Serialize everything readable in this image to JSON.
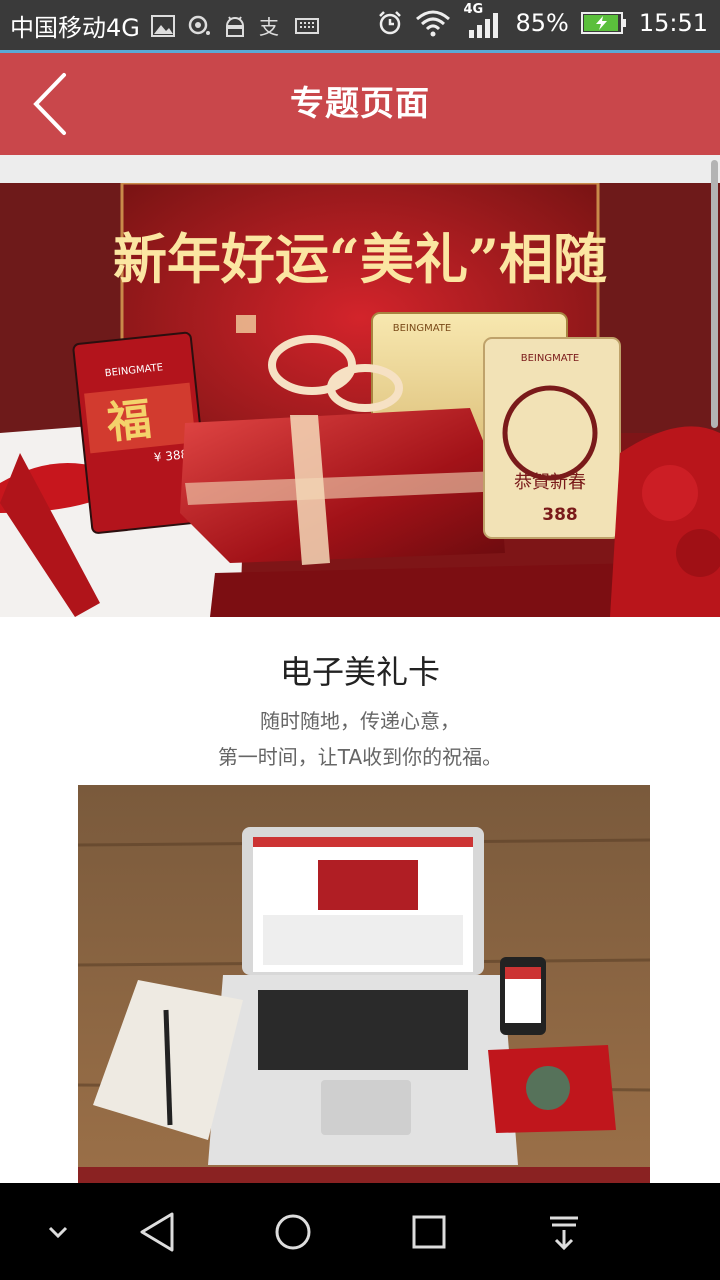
{
  "status_bar": {
    "carrier": "中国移动4G",
    "network_badge": "4G",
    "battery": "85%",
    "time": "15:51",
    "icons": [
      "image-icon",
      "location-icon",
      "android-icon",
      "alipay-icon",
      "keyboard-icon",
      "alarm-icon",
      "wifi-icon",
      "signal-icon",
      "battery-icon"
    ]
  },
  "header": {
    "title": "专题页面",
    "back_icon": "chevron-left-icon",
    "color": "#c9474b"
  },
  "banner": {
    "headline": "新年好运“美礼”相随",
    "card_brand": "BEINGMATE",
    "card_price": "388",
    "card_price_small": "¥ 388",
    "fu_char": "福",
    "card_greeting": "恭賀新春"
  },
  "section": {
    "title": "电子美礼卡",
    "desc_line1": "随时随地，传递心意，",
    "desc_line2": "第一时间，让TA收到你的祝福。"
  },
  "nav_bar": {
    "icons": [
      "chevron-down-icon",
      "back-triangle-icon",
      "home-circle-icon",
      "recents-square-icon",
      "download-icon"
    ]
  }
}
